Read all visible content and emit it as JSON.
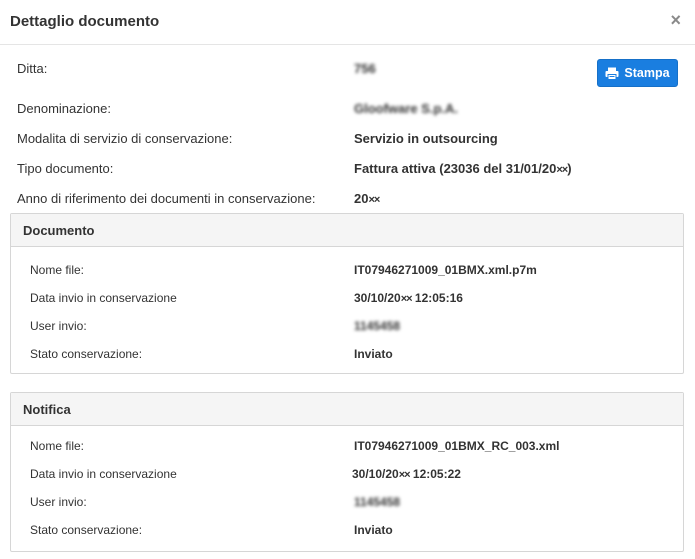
{
  "header": {
    "title": "Dettaglio documento",
    "close_symbol": "×"
  },
  "toolbar": {
    "print_label": "Stampa",
    "print_icon": "print-icon"
  },
  "fields": {
    "ditta_label": "Ditta:",
    "ditta_value": "756",
    "denominazione_label": "Denominazione:",
    "denominazione_value": "Gloofware S.p.A.",
    "modalita_label": "Modalita di servizio di conservazione:",
    "modalita_value": "Servizio in outsourcing",
    "tipo_label": "Tipo documento:",
    "tipo_value": "Fattura attiva (23036 del 31/01/20",
    "tipo_mask": "××",
    "tipo_suffix": ")",
    "anno_label": "Anno di riferimento dei documenti in conservazione:",
    "anno_value": "20",
    "anno_mask": "××"
  },
  "documento": {
    "title": "Documento",
    "nome_file_label": "Nome file:",
    "nome_file_value": "IT07946271009_01BMX.xml.p7m",
    "data_invio_label": "Data invio in conservazione",
    "data_invio_prefix": "30/10/20",
    "data_invio_mask": "××",
    "data_invio_suffix": " 12:05:16",
    "user_label": "User invio:",
    "user_value": "1145458",
    "stato_label": "Stato conservazione:",
    "stato_value": "Inviato"
  },
  "notifica": {
    "title": "Notifica",
    "nome_file_label": "Nome file:",
    "nome_file_value": "IT07946271009_01BMX_RC_003.xml",
    "data_invio_label": "Data invio in conservazione",
    "data_invio_prefix": "30/10/20",
    "data_invio_mask": "××",
    "data_invio_suffix": " 12:05:22",
    "user_label": "User invio:",
    "user_value": "1145458",
    "stato_label": "Stato conservazione:",
    "stato_value": "Inviato"
  },
  "colors": {
    "primary": "#1a7ee0",
    "panel_header_bg": "#f5f5f5",
    "border": "#d6d6d6"
  }
}
